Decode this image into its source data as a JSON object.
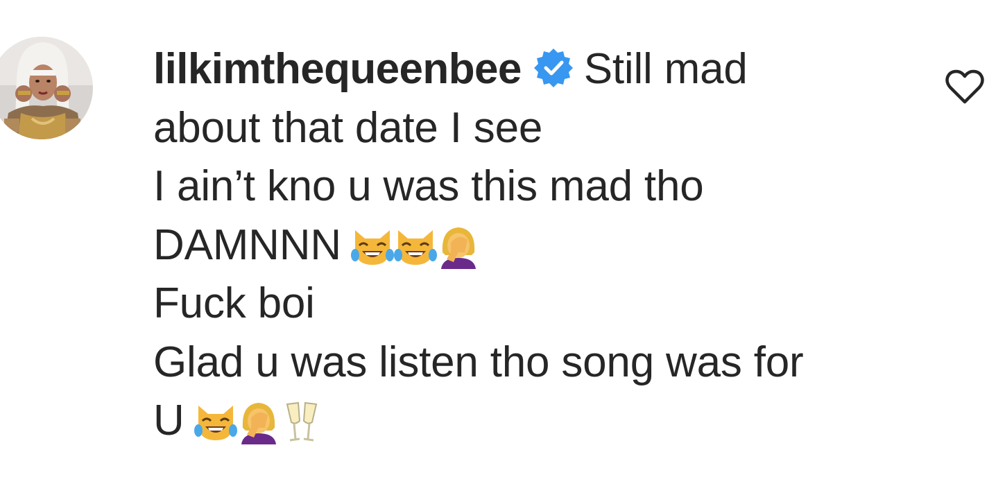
{
  "comment": {
    "username": "lilkimthequeenbee",
    "verified": true,
    "avatar": "avatar-photo",
    "lines": [
      "Still mad",
      "about that date I see",
      "I ain’t kno u was this mad tho",
      "DAMNNN",
      "Fuck boi",
      "Glad u was listen tho song was for",
      "U"
    ],
    "emojis_line_4": [
      "cat-tears-of-joy",
      "cat-tears-of-joy",
      "woman-facepalming"
    ],
    "emojis_line_7": [
      "cat-tears-of-joy",
      "woman-facepalming",
      "clinking-glasses"
    ]
  },
  "icons": {
    "like": "heart-outline-icon",
    "verified": "verified-badge-icon"
  },
  "colors": {
    "text": "#262626",
    "verified_blue": "#3897f0"
  }
}
